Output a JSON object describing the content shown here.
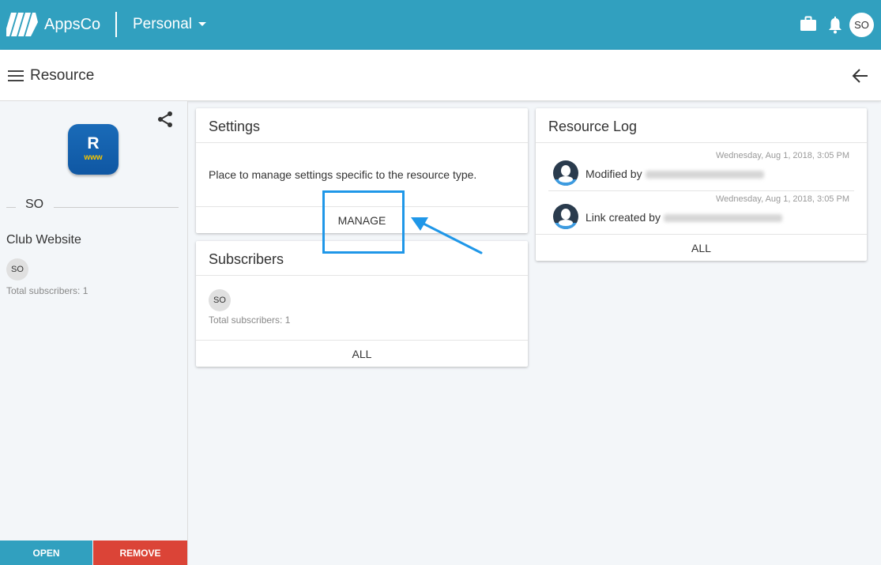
{
  "header": {
    "brand": "AppsCo",
    "workspace": "Personal",
    "user_initials": "SO"
  },
  "subheader": {
    "title": "Resource"
  },
  "sidebar": {
    "icon_letter": "R",
    "icon_sub": "www",
    "owner": "SO",
    "resource_name": "Club Website",
    "subscriber_initials": "SO",
    "total_subscribers": "Total subscribers: 1",
    "open_label": "OPEN",
    "remove_label": "REMOVE"
  },
  "settings": {
    "title": "Settings",
    "description": "Place to manage settings specific to the resource type.",
    "manage_label": "MANAGE"
  },
  "subscribers": {
    "title": "Subscribers",
    "subscriber_initials": "SO",
    "total": "Total subscribers: 1",
    "all_label": "ALL"
  },
  "resource_log": {
    "title": "Resource Log",
    "entries": [
      {
        "time": "Wednesday, Aug 1, 2018, 3:05 PM",
        "action": "Modified by"
      },
      {
        "time": "Wednesday, Aug 1, 2018, 3:05 PM",
        "action": "Link created by"
      }
    ],
    "all_label": "ALL"
  },
  "colors": {
    "primary": "#31a0bf",
    "danger": "#db4437",
    "annotation": "#1f97e8"
  }
}
